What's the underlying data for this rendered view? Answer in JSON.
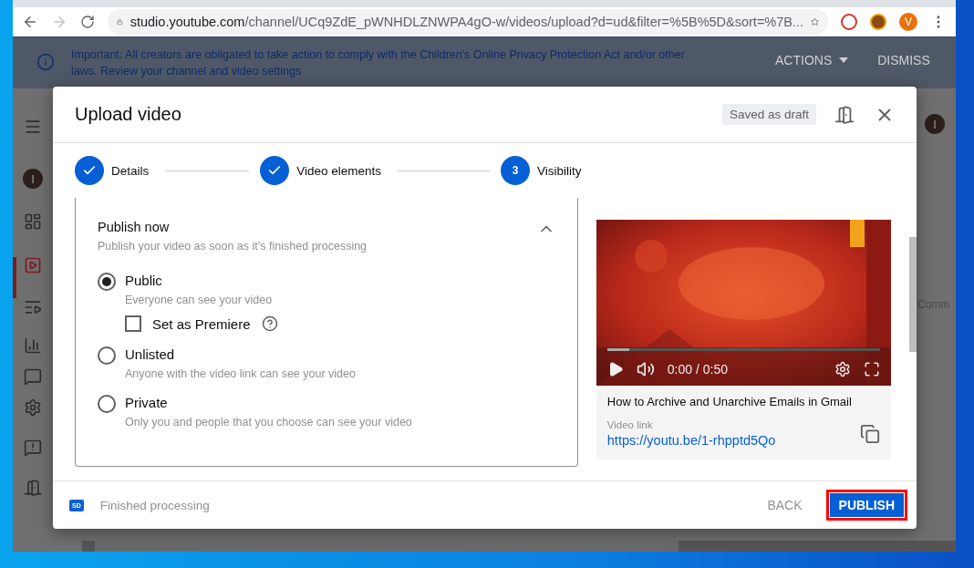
{
  "browser": {
    "url_host": "studio.youtube.com",
    "url_path": "/channel/UCq9ZdE_pWNHDLZNWPA4gO-w/videos/upload?d=ud&filter=%5B%5D&sort=%7B...",
    "profile_initial": "V"
  },
  "banner": {
    "lines": [
      "Important: All creators are obligated to take action to comply with the Children's Online Privacy Protection Act and/or other",
      "laws. Review your channel and video settings"
    ],
    "actions": "ACTIONS",
    "dismiss": "DISMISS"
  },
  "backdrop": {
    "sidebar_avatar": "I",
    "header_avatar": "I",
    "column_text": "Comm"
  },
  "dialog": {
    "title": "Upload video",
    "draft_status": "Saved as draft",
    "steps": [
      {
        "label": "Details",
        "kind": "done"
      },
      {
        "label": "Video elements",
        "kind": "done"
      },
      {
        "label": "Visibility",
        "kind": "current",
        "number": "3"
      }
    ],
    "section": {
      "title": "Publish now",
      "subtitle": "Publish your video as soon as it’s finished processing",
      "expanded": true
    },
    "options": [
      {
        "label": "Public",
        "description": "Everyone can see your video",
        "selected": true
      },
      {
        "label": "Unlisted",
        "description": "Anyone with the video link can see your video",
        "selected": false
      },
      {
        "label": "Private",
        "description": "Only you and people that you choose can see your video",
        "selected": false
      }
    ],
    "premiere": {
      "label": "Set as Premiere",
      "checked": false
    },
    "preview": {
      "kind": "picture",
      "time": "0:00 / 0:50",
      "level": 0.08,
      "video_title": "How to Archive and Unarchive Emails in Gmail",
      "link_label": "Video link",
      "link": "https://youtu.be/1-rhpptd5Qo"
    },
    "footer": {
      "badge": "SD",
      "status": "Finished processing",
      "back": "BACK",
      "publish": "PUBLISH",
      "publish_highlighted": true
    }
  }
}
